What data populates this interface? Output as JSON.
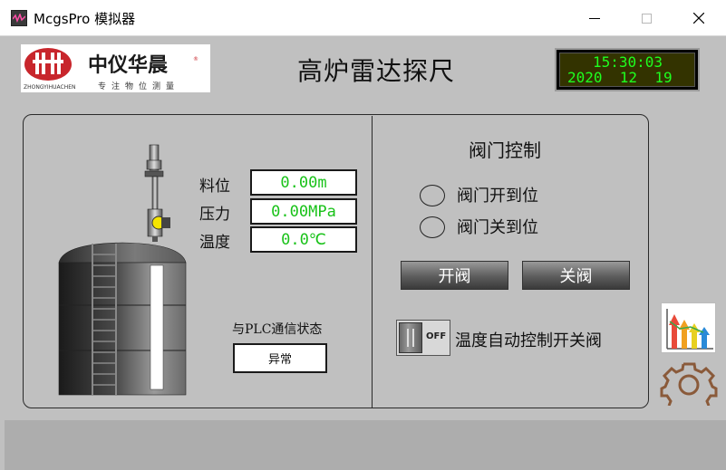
{
  "window": {
    "title": "McgsPro 模拟器",
    "controls": {
      "minimize": "minimize",
      "maximize": "maximize",
      "close": "close"
    }
  },
  "header": {
    "logo": {
      "brand_cn": "中仪华晨",
      "brand_en": "ZHONGYIHUACHEN",
      "slogan": "专注物位测量",
      "mark": "R"
    },
    "title": "高炉雷达探尺",
    "clock": {
      "time": "15:30:03",
      "date": "2020  12  19",
      "text_color": "#1fff1f"
    }
  },
  "params": [
    {
      "label": "料位",
      "value": "0.00m"
    },
    {
      "label": "压力",
      "value": "0.00MPa"
    },
    {
      "label": "温度",
      "value": "0.0℃"
    }
  ],
  "plc": {
    "label": "与PLC通信状态",
    "status": "异常"
  },
  "valve": {
    "title": "阀门控制",
    "indicators": [
      {
        "label": "阀门开到位"
      },
      {
        "label": "阀门关到位"
      }
    ],
    "open_button": "开阀",
    "close_button": "关阀",
    "toggle_state": "OFF",
    "toggle_label": "温度自动控制开关阀"
  },
  "icons": {
    "chart": "bar-chart-arrows-icon",
    "settings": "gear-icon"
  },
  "colors": {
    "panel_bg": "#c0c0c0",
    "value_text": "#19c219",
    "footer": "#adadad"
  }
}
